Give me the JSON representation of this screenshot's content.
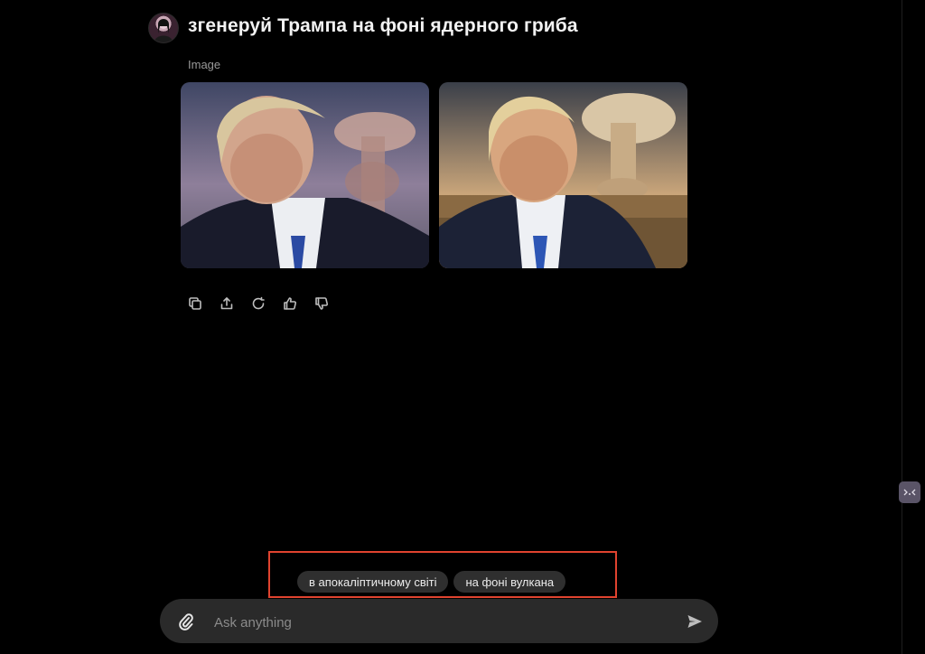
{
  "conversation": {
    "prompt": "згенеруй Трампа на фоні ядерного гриба",
    "image_label": "Image",
    "images": [
      {
        "icon": "generated-image-1"
      },
      {
        "icon": "generated-image-2"
      }
    ]
  },
  "actions": [
    {
      "icon": "copy-icon"
    },
    {
      "icon": "share-icon"
    },
    {
      "icon": "regenerate-icon"
    },
    {
      "icon": "thumbs-up-icon"
    },
    {
      "icon": "thumbs-down-icon"
    }
  ],
  "suggestions": [
    "в апокаліптичному світі",
    "на фоні вулкана"
  ],
  "composer": {
    "placeholder": "Ask anything"
  },
  "colors": {
    "background": "#000000",
    "highlight": "#e0432f",
    "chip": "#2f2f2f",
    "composer": "#2a2a2a"
  }
}
